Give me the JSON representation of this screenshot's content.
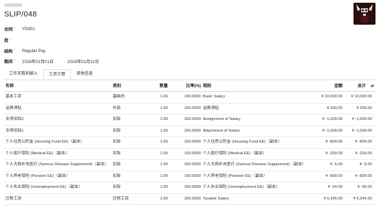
{
  "header": {
    "breadcrumb_placeholder": "",
    "title": "SLIP/048"
  },
  "avatar": {
    "icon": "user-photo-icon"
  },
  "fields": {
    "contract": {
      "label": "合同",
      "value": "YD001"
    },
    "batch": {
      "label": "批",
      "value": ""
    },
    "structure": {
      "label": "结构",
      "value": "Regular Pay"
    },
    "period": {
      "label": "期间",
      "from": "2026年01月01日",
      "separator": "-",
      "to": "2026年01月31日"
    }
  },
  "tabs": [
    {
      "label": "工作天数和输入",
      "active": false
    },
    {
      "label": "工资计算",
      "active": true
    },
    {
      "label": "其他信息",
      "active": false
    }
  ],
  "table": {
    "headers": {
      "name": "名称",
      "category": "类别",
      "quantity": "数量",
      "rate": "比率(%)",
      "rule": "规则",
      "amount": "金额",
      "total": "总计"
    },
    "rows": [
      {
        "name": "基本工资",
        "category": "基础的",
        "quantity": "1.00",
        "rate": "100.0000",
        "rule": "Basic Salary",
        "amount": "¥ 10,000.00",
        "total": "¥ 10,000.00"
      },
      {
        "name": "话费津贴",
        "category": "补助",
        "quantity": "1.00",
        "rate": "100.0000",
        "rule": "话费津贴",
        "amount": "¥ 200.00",
        "total": "¥ 200.00"
      },
      {
        "name": "专项扣除2",
        "category": "扣除",
        "quantity": "1.00",
        "rate": "100.0000",
        "rule": "Assignment of Salary",
        "amount": "¥ -1,000.00",
        "total": "¥ -1,000.00"
      },
      {
        "name": "专项扣除1",
        "category": "扣除",
        "quantity": "1.00",
        "rate": "100.0000",
        "rule": "Attachment of Salary",
        "amount": "¥ -1,000.00",
        "total": "¥ -1,000.00"
      },
      {
        "name": "个人住房公积金 (Housing Fund EE)（副本）",
        "category": "扣除",
        "quantity": "1.00",
        "rate": "100.0000",
        "rule": "个人住房公积金 (Housing Fund EE)（副本）",
        "amount": "¥ -800.00",
        "total": "¥ -800.00"
      },
      {
        "name": "个人医疗保险 (Medical EE)（副本）",
        "category": "扣除",
        "quantity": "1.00",
        "rate": "100.0000",
        "rule": "个人医疗保险 (Medical EE)（副本）",
        "amount": "¥ -200.00",
        "total": "¥ -200.00"
      },
      {
        "name": "个人大病补充医疗 (Serious Disease Supplement)（副本）",
        "category": "扣除",
        "quantity": "1.00",
        "rate": "100.0000",
        "rule": "个人大病补充医疗 (Serious Disease Supplement)（副本）",
        "amount": "¥ -5.00",
        "total": "¥ -5.00"
      },
      {
        "name": "个人养老保险 (Pension EE)（副本）",
        "category": "扣除",
        "quantity": "1.00",
        "rate": "100.0000",
        "rule": "个人养老保险 (Pension EE)（副本）",
        "amount": "¥ -800.00",
        "total": "¥ -800.00"
      },
      {
        "name": "个人失业保险 (Unemployment EE)（副本）",
        "category": "扣除",
        "quantity": "1.00",
        "rate": "100.0000",
        "rule": "个人失业保险 (Unemployment EE)（副本）",
        "amount": "¥ -50.00",
        "total": "¥ -50.00"
      },
      {
        "name": "应税工资",
        "category": "应税工资",
        "quantity": "1.00",
        "rate": "100.0000",
        "rule": "Taxable Salary",
        "amount": "¥ 6,345.00",
        "total": "¥ 6,345.00"
      }
    ]
  },
  "colors": {
    "border": "#dcdcdc",
    "text": "#222222",
    "avatar_bg": "#2a0d0d"
  }
}
